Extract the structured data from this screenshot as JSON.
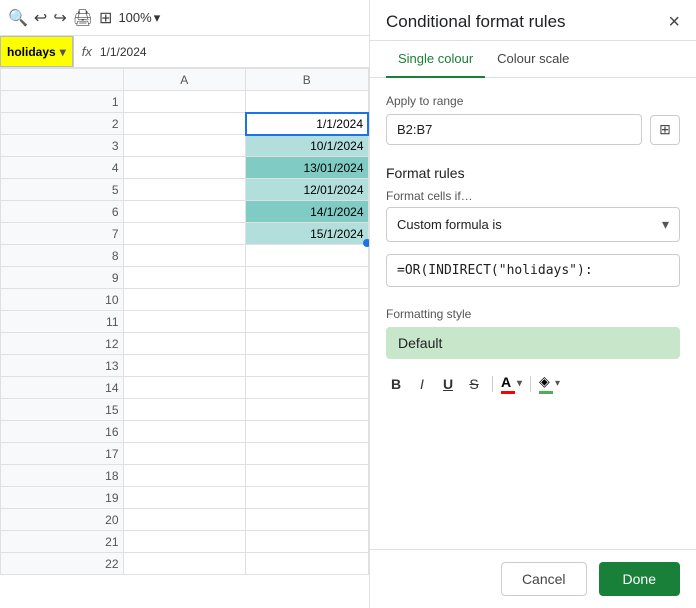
{
  "toolbar": {
    "zoom": "100%",
    "zoom_arrow": "▾"
  },
  "formula_bar": {
    "cell_name": "holidays",
    "cell_name_arrow": "▾",
    "fx": "fx",
    "value": "1/1/2024"
  },
  "grid": {
    "col_headers": [
      "",
      "A",
      "B"
    ],
    "rows": [
      {
        "num": "1",
        "a": "",
        "b": ""
      },
      {
        "num": "2",
        "a": "",
        "b": "1/1/2024",
        "style": "selected"
      },
      {
        "num": "3",
        "a": "",
        "b": "10/1/2024",
        "style": "teal"
      },
      {
        "num": "4",
        "a": "",
        "b": "13/01/2024",
        "style": "darker"
      },
      {
        "num": "5",
        "a": "",
        "b": "12/01/2024",
        "style": "teal"
      },
      {
        "num": "6",
        "a": "",
        "b": "14/1/2024",
        "style": "darker"
      },
      {
        "num": "7",
        "a": "",
        "b": "15/1/2024",
        "style": "last"
      },
      {
        "num": "8",
        "a": "",
        "b": ""
      },
      {
        "num": "9",
        "a": "",
        "b": ""
      },
      {
        "num": "10",
        "a": "",
        "b": ""
      },
      {
        "num": "11",
        "a": "",
        "b": ""
      },
      {
        "num": "12",
        "a": "",
        "b": ""
      },
      {
        "num": "13",
        "a": "",
        "b": ""
      },
      {
        "num": "14",
        "a": "",
        "b": ""
      },
      {
        "num": "15",
        "a": "",
        "b": ""
      },
      {
        "num": "16",
        "a": "",
        "b": ""
      },
      {
        "num": "17",
        "a": "",
        "b": ""
      },
      {
        "num": "18",
        "a": "",
        "b": ""
      },
      {
        "num": "19",
        "a": "",
        "b": ""
      },
      {
        "num": "20",
        "a": "",
        "b": ""
      },
      {
        "num": "21",
        "a": "",
        "b": ""
      },
      {
        "num": "22",
        "a": "",
        "b": ""
      }
    ]
  },
  "panel": {
    "title": "Conditional format rules",
    "close": "×",
    "tabs": [
      {
        "label": "Single colour",
        "active": true
      },
      {
        "label": "Colour scale",
        "active": false
      }
    ],
    "apply_to_range": {
      "label": "Apply to range",
      "value": "B2:B7",
      "icon": "⊞"
    },
    "format_rules": {
      "title": "Format rules",
      "cells_label": "Format cells if…",
      "dropdown_value": "Custom formula is",
      "formula_value": "=OR(INDIRECT(\"holidays\"):"
    },
    "formatting_style": {
      "label": "Formatting style",
      "preview_text": "Default",
      "bold": "B",
      "italic": "I",
      "underline": "U",
      "strikethrough": "S",
      "text_color": "A",
      "fill_icon": "◈"
    },
    "footer": {
      "cancel": "Cancel",
      "done": "Done"
    }
  }
}
